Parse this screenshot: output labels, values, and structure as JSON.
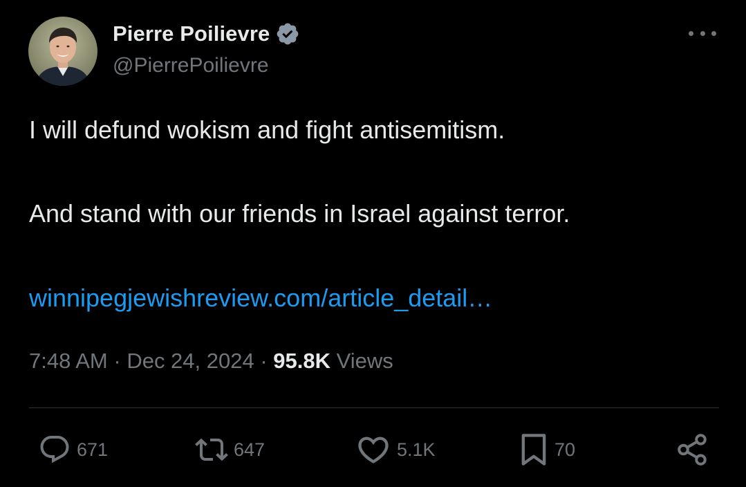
{
  "author": {
    "display_name": "Pierre Poilievre",
    "handle": "@PierrePoilievre",
    "verified_icon": "verified-badge-icon",
    "verified_color": "#8b98a5"
  },
  "tweet": {
    "line1": "I will defund wokism and fight antisemitism.",
    "line2": "And stand with our friends in Israel against terror.",
    "link_text": "winnipegjewishreview.com/article_detail…"
  },
  "meta": {
    "time": "7:48 AM",
    "separator": " · ",
    "date": "Dec 24, 2024",
    "views_count": "95.8K",
    "views_label": " Views"
  },
  "actions": {
    "reply": {
      "icon": "reply-icon",
      "count": "671"
    },
    "repost": {
      "icon": "repost-icon",
      "count": "647"
    },
    "like": {
      "icon": "heart-icon",
      "count": "5.1K"
    },
    "bookmark": {
      "icon": "bookmark-icon",
      "count": "70"
    },
    "share": {
      "icon": "share-icon"
    }
  },
  "colors": {
    "background": "#000000",
    "primary_text": "#e7e9ea",
    "secondary_text": "#71767b",
    "link": "#1d9bf0",
    "divider": "#2f3336"
  }
}
